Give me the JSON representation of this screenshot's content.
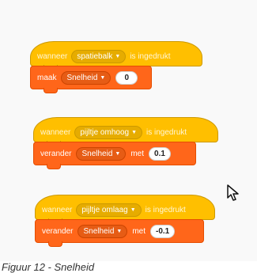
{
  "scripts": [
    {
      "hat": {
        "label": "wanneer",
        "key": "spatiebalk",
        "suffix": "is ingedrukt"
      },
      "command": {
        "label": "maak",
        "variable": "Snelheid",
        "middle": "",
        "value": "0"
      }
    },
    {
      "hat": {
        "label": "wanneer",
        "key": "pijltje omhoog",
        "suffix": "is ingedrukt"
      },
      "command": {
        "label": "verander",
        "variable": "Snelheid",
        "middle": "met",
        "value": "0.1"
      }
    },
    {
      "hat": {
        "label": "wanneer",
        "key": "pijltje omlaag",
        "suffix": "is ingedrukt"
      },
      "command": {
        "label": "verander",
        "variable": "Snelheid",
        "middle": "met",
        "value": "-0.1"
      }
    }
  ],
  "caption": "Figuur 12 - Snelheid",
  "colors": {
    "events": "#ffbf00",
    "variables": "#ff661a"
  },
  "icons": {
    "cursor": "mouse-pointer-icon",
    "dropdown": "caret-down-icon"
  }
}
